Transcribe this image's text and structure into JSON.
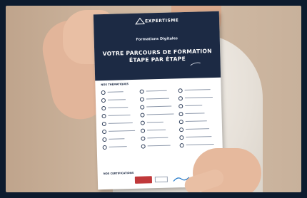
{
  "brochure": {
    "brand": "EXPERTISME",
    "brand_tagline": "",
    "kicker": "Formations Digitales",
    "title_line1": "VOTRE PARCOURS DE FORMATION",
    "title_line2": "ÉTAPE PAR ÉTAPE",
    "section_themes": "NOS THÉMATIQUES",
    "section_certifications": "NOS CERTIFICATIONS"
  },
  "colors": {
    "brochure_header": "#1c2a44",
    "frame": "#0d1b2e",
    "shirt": "#f3efe9"
  },
  "grid_item_count": 24
}
